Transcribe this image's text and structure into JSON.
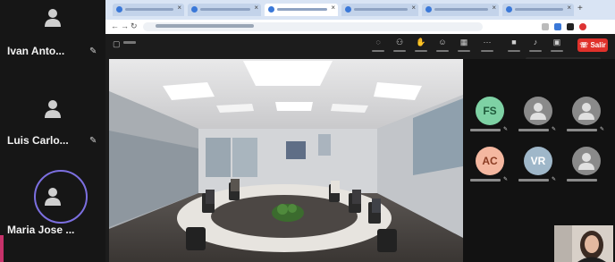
{
  "left_participants": [
    {
      "name": "Ivan Anto...",
      "icon": "muted-mic-icon"
    },
    {
      "name": "Luis Carlo...",
      "icon": "muted-mic-icon"
    },
    {
      "name": "Maria Jose ...",
      "speaking": true
    }
  ],
  "gallery": [
    {
      "initials": "FS",
      "color": "#7ed1a4",
      "text_color": "#1f5a3b"
    },
    {
      "initials": "",
      "color": "#8a8a8a",
      "icon": "user-icon"
    },
    {
      "initials": "",
      "color": "#8a8a8a",
      "icon": "user-icon"
    },
    {
      "initials": "AC",
      "color": "#f4b7a0",
      "text_color": "#8a3b22"
    },
    {
      "initials": "VR",
      "color": "#9fb7c9",
      "text_color": "#ffffff"
    },
    {
      "initials": "",
      "color": "#8a8a8a",
      "icon": "user-icon"
    }
  ],
  "meeting": {
    "leave_label": "Salir"
  },
  "colors": {
    "leave": "#e0312b",
    "speaker_ring": "#7c6fe0",
    "tab_bar": "#d9e4f4"
  }
}
